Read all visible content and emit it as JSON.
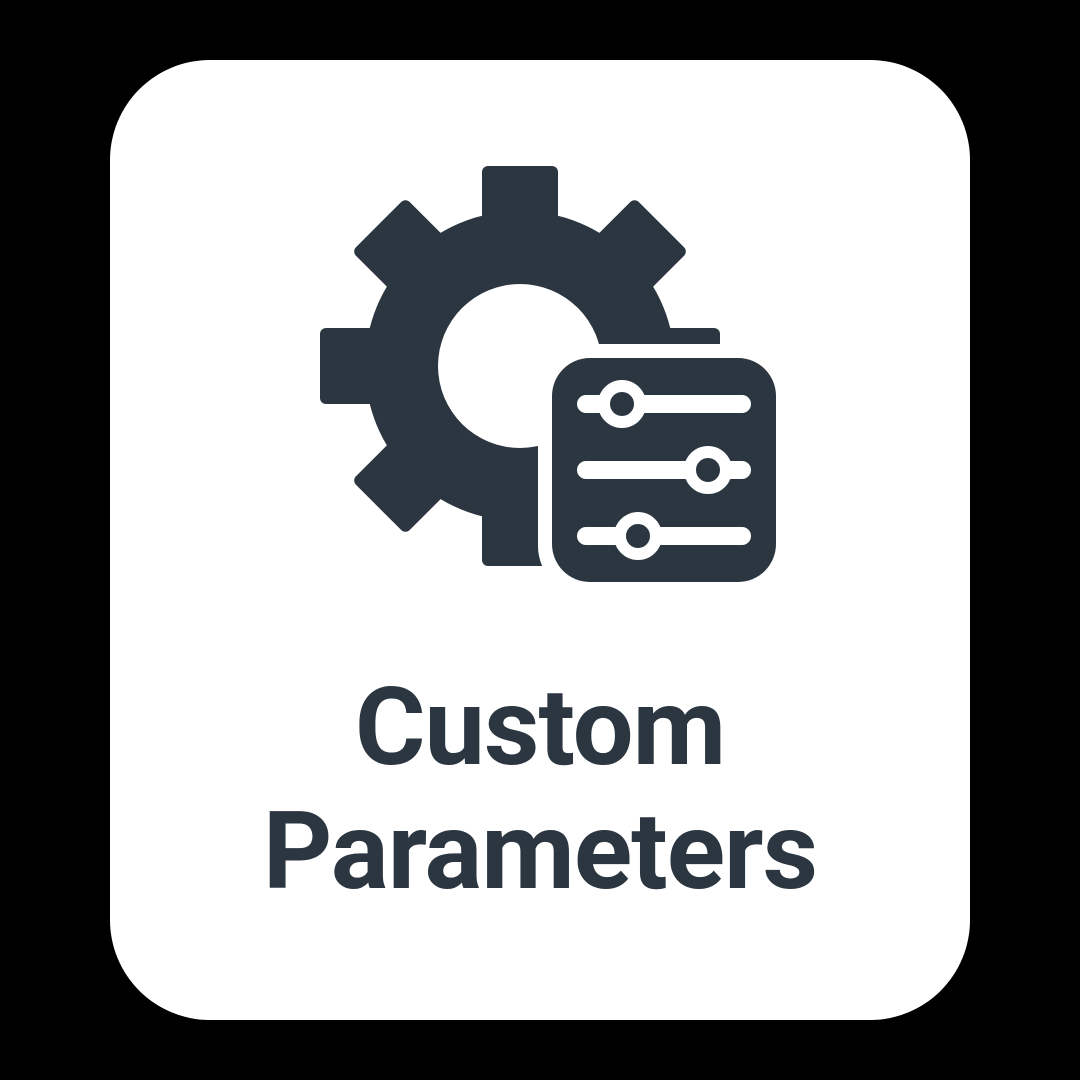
{
  "tile": {
    "label_line1": "Custom",
    "label_line2": "Parameters",
    "icon_name": "custom-parameters-icon"
  },
  "colors": {
    "background": "#000000",
    "card": "#ffffff",
    "foreground": "#2b3640"
  }
}
